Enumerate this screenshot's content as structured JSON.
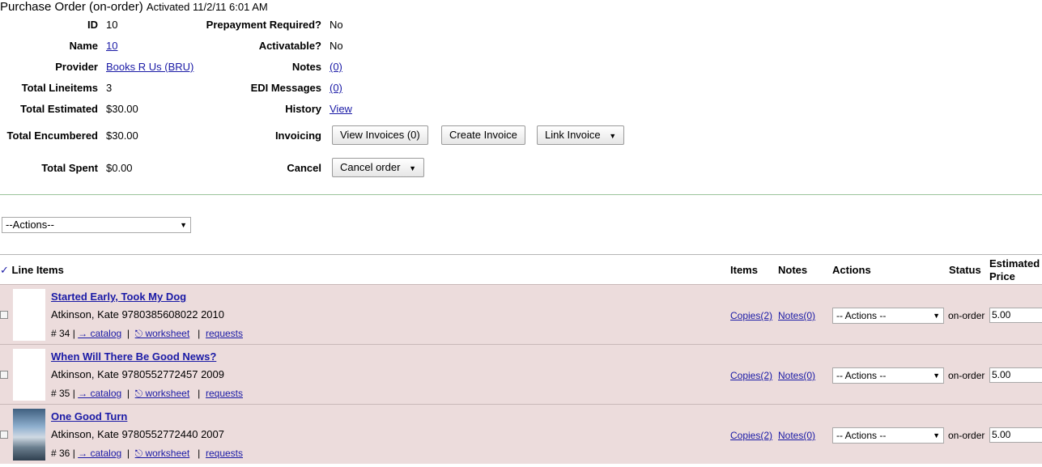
{
  "header": {
    "title": "Purchase Order (on-order)",
    "activated": "Activated 11/2/11 6:01 AM"
  },
  "fields": {
    "id_label": "ID",
    "id_value": "10",
    "name_label": "Name",
    "name_value": "10",
    "provider_label": "Provider",
    "provider_value": "Books R Us (BRU)",
    "total_lineitems_label": "Total Lineitems",
    "total_lineitems_value": "3",
    "total_estimated_label": "Total Estimated",
    "total_estimated_value": "$30.00",
    "total_encumbered_label": "Total Encumbered",
    "total_encumbered_value": "$30.00",
    "total_spent_label": "Total Spent",
    "total_spent_value": "$0.00",
    "prepayment_label": "Prepayment Required?",
    "prepayment_value": "No",
    "activatable_label": "Activatable?",
    "activatable_value": "No",
    "notes_label": "Notes",
    "notes_value": "(0)",
    "edi_label": "EDI Messages",
    "edi_value": "(0)",
    "history_label": "History",
    "history_value": "View",
    "invoicing_label": "Invoicing",
    "cancel_label": "Cancel"
  },
  "buttons": {
    "view_invoices": "View Invoices (0)",
    "create_invoice": "Create Invoice",
    "link_invoice": "Link Invoice",
    "cancel_order": "Cancel order",
    "dropdown_caret": "▼"
  },
  "actions_select": "--Actions--",
  "table": {
    "check_mark": "✓",
    "columns": {
      "line_items": "Line Items",
      "items": "Items",
      "notes": "Notes",
      "actions": "Actions",
      "status": "Status",
      "estimated_price_1": "Estimated",
      "estimated_price_2": "Price"
    },
    "rows": [
      {
        "title": "Started Early, Took My Dog",
        "author": "Atkinson, Kate",
        "isbn": "9780385608022",
        "year": "2010",
        "number": "# 34 |",
        "catalog": "→ catalog",
        "worksheet": "⎋ worksheet",
        "requests": "requests",
        "copies": "Copies(2)",
        "notes": "Notes(0)",
        "actions": "-- Actions --",
        "status": "on-order",
        "price": "5.00",
        "has_image": false
      },
      {
        "title": "When Will There Be Good News?",
        "author": "Atkinson, Kate",
        "isbn": "9780552772457",
        "year": "2009",
        "number": "# 35 |",
        "catalog": "→ catalog",
        "worksheet": "⎋ worksheet",
        "requests": "requests",
        "copies": "Copies(2)",
        "notes": "Notes(0)",
        "actions": "-- Actions --",
        "status": "on-order",
        "price": "5.00",
        "has_image": false
      },
      {
        "title": "One Good Turn",
        "author": "Atkinson, Kate",
        "isbn": "9780552772440",
        "year": "2007",
        "number": "# 36 |",
        "catalog": "→ catalog",
        "worksheet": "⎋ worksheet",
        "requests": "requests",
        "copies": "Copies(2)",
        "notes": "Notes(0)",
        "actions": "-- Actions --",
        "status": "on-order",
        "price": "5.00",
        "has_image": true
      }
    ]
  },
  "colors": {
    "row_background": "#ecdcdc",
    "link": "#1a1aa6",
    "separator_green": "#9bc49b"
  }
}
